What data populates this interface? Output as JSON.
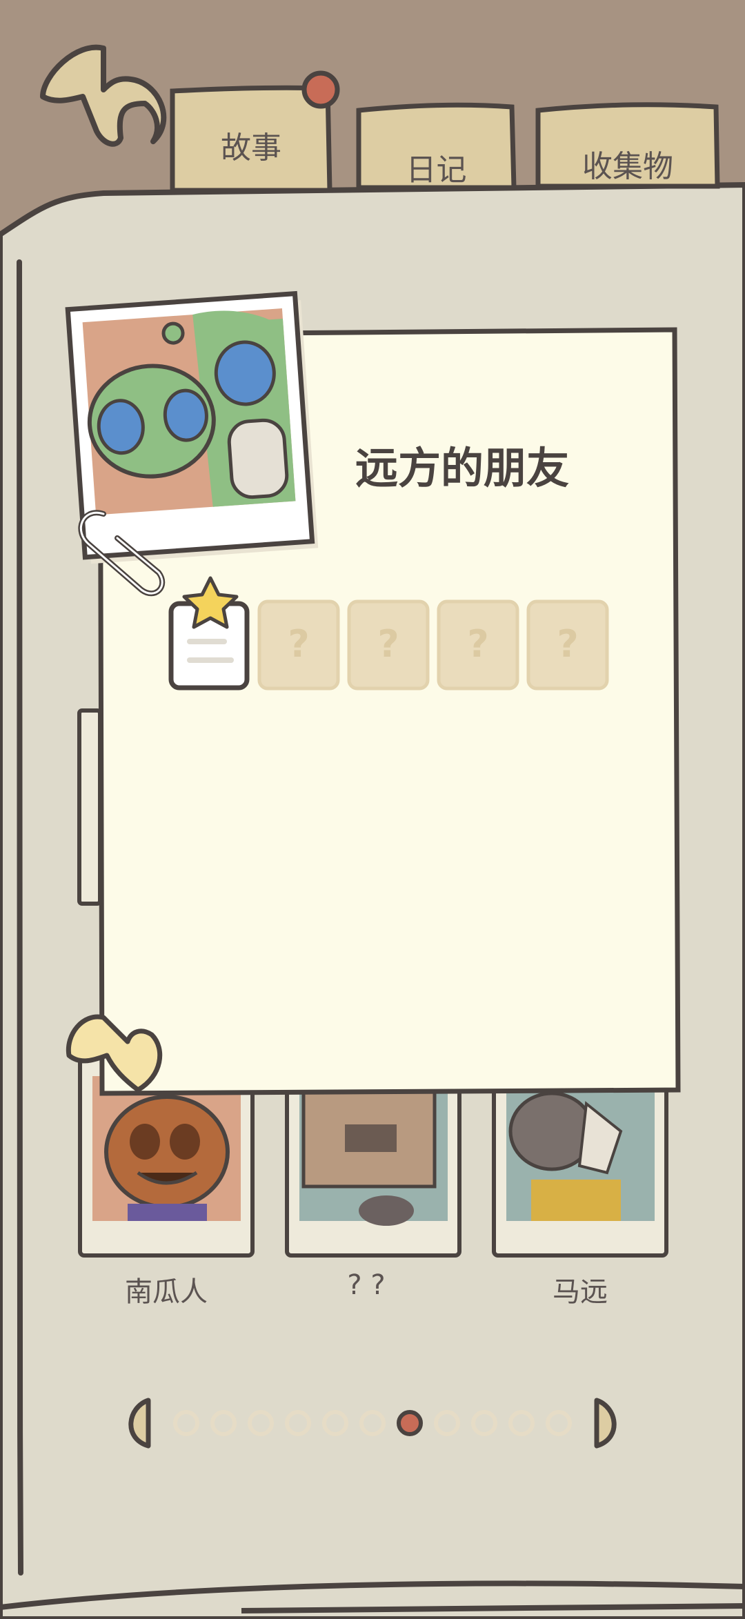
{
  "tabs": [
    {
      "label": "故事",
      "active": true
    },
    {
      "label": "日记",
      "active": false
    },
    {
      "label": "收集物",
      "active": false
    }
  ],
  "story_card": {
    "title": "远方的朋友",
    "locked_slot_mark": "?",
    "locked_slot_count": 4
  },
  "characters": [
    {
      "name": "南瓜人"
    },
    {
      "name": "? ?"
    },
    {
      "name": "马远"
    }
  ],
  "pagination": {
    "total_pages": 11,
    "current_page": 7
  },
  "colors": {
    "background": "#a79382",
    "book_page": "#dedacb",
    "card": "#fdfbe8",
    "outline": "#4a4340",
    "tab": "#ddcda3",
    "accent_dot": "#c86c57",
    "locked_slot": "#eadcbc",
    "alien_green": "#8fbf84",
    "alien_eye": "#5b8fcd",
    "pumpkin": "#b46a3c",
    "star": "#f4d35c"
  },
  "icons": [
    "back-arrow-icon",
    "paperclip-icon",
    "collapse-arrow-icon",
    "prev-page-icon",
    "next-page-icon",
    "story-note-icon",
    "star-icon"
  ]
}
